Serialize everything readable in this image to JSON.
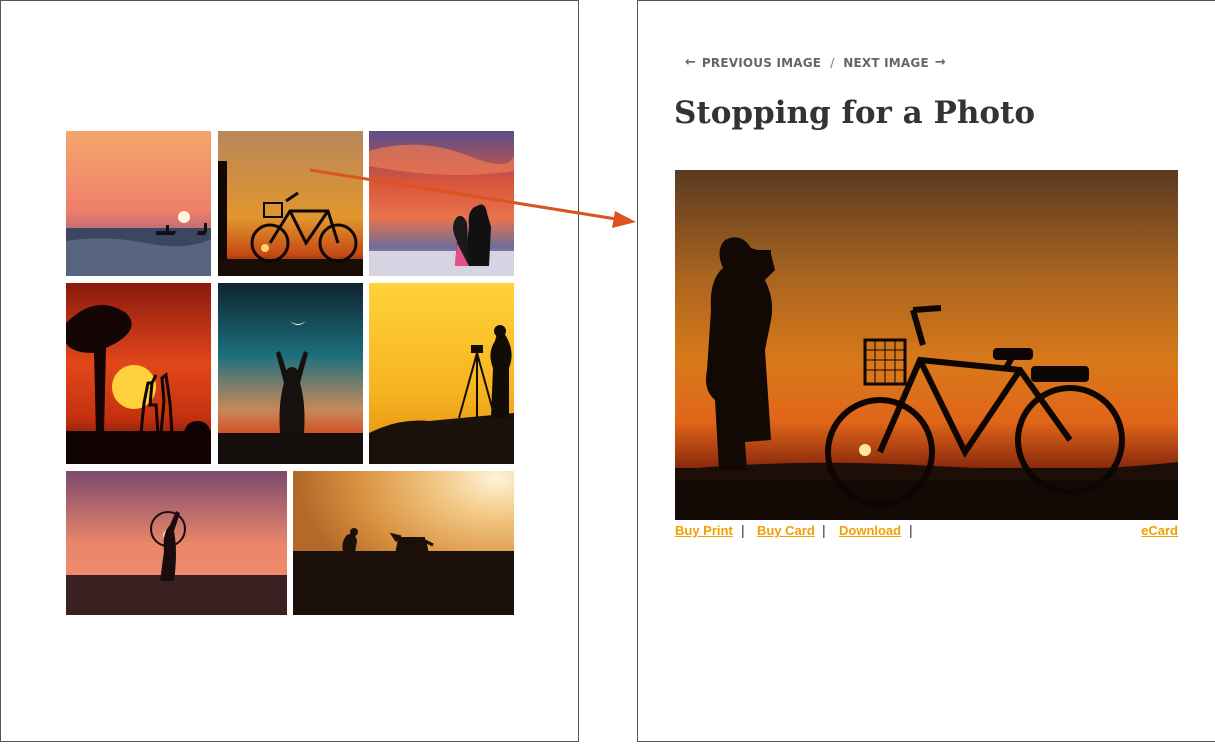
{
  "gallery": {
    "thumbnails": [
      {
        "name": "sunset-sea-kayakers"
      },
      {
        "name": "stopping-for-a-photo"
      },
      {
        "name": "couple-red-clouds"
      },
      {
        "name": "giraffes-sunset"
      },
      {
        "name": "moon-reach"
      },
      {
        "name": "photographer-tripod"
      },
      {
        "name": "hula-hoop-beach"
      },
      {
        "name": "dog-and-owner"
      }
    ]
  },
  "detail": {
    "nav": {
      "previous_label": "PREVIOUS IMAGE",
      "separator": "/",
      "next_label": "NEXT IMAGE"
    },
    "title": "Stopping for a Photo",
    "links": {
      "buy_print": "Buy Print",
      "buy_card": "Buy Card",
      "download": "Download",
      "ecard": "eCard",
      "divider": "|"
    }
  },
  "colors": {
    "link": "#f0a000",
    "annotation_arrow": "#d9541e",
    "title": "#333333"
  }
}
